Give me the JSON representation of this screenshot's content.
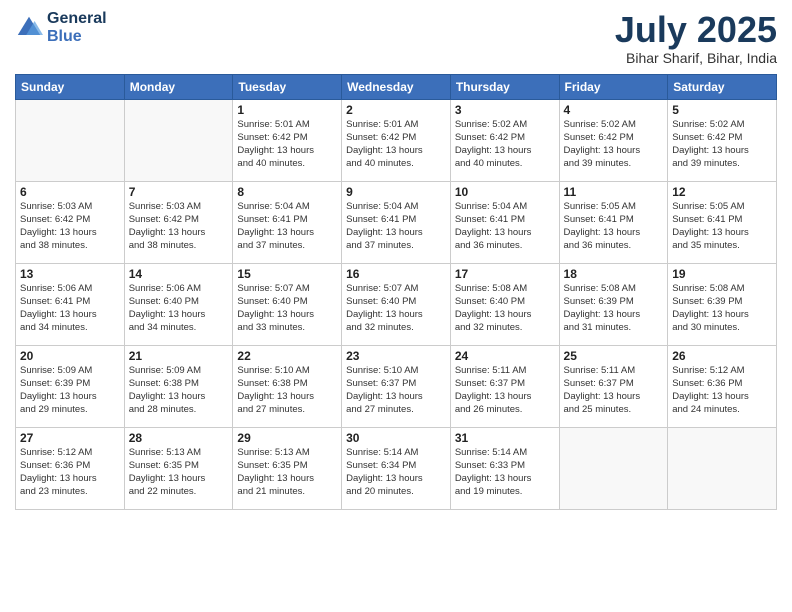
{
  "logo": {
    "line1": "General",
    "line2": "Blue"
  },
  "title": "July 2025",
  "location": "Bihar Sharif, Bihar, India",
  "days_of_week": [
    "Sunday",
    "Monday",
    "Tuesday",
    "Wednesday",
    "Thursday",
    "Friday",
    "Saturday"
  ],
  "weeks": [
    [
      {
        "day": "",
        "info": ""
      },
      {
        "day": "",
        "info": ""
      },
      {
        "day": "1",
        "info": "Sunrise: 5:01 AM\nSunset: 6:42 PM\nDaylight: 13 hours\nand 40 minutes."
      },
      {
        "day": "2",
        "info": "Sunrise: 5:01 AM\nSunset: 6:42 PM\nDaylight: 13 hours\nand 40 minutes."
      },
      {
        "day": "3",
        "info": "Sunrise: 5:02 AM\nSunset: 6:42 PM\nDaylight: 13 hours\nand 40 minutes."
      },
      {
        "day": "4",
        "info": "Sunrise: 5:02 AM\nSunset: 6:42 PM\nDaylight: 13 hours\nand 39 minutes."
      },
      {
        "day": "5",
        "info": "Sunrise: 5:02 AM\nSunset: 6:42 PM\nDaylight: 13 hours\nand 39 minutes."
      }
    ],
    [
      {
        "day": "6",
        "info": "Sunrise: 5:03 AM\nSunset: 6:42 PM\nDaylight: 13 hours\nand 38 minutes."
      },
      {
        "day": "7",
        "info": "Sunrise: 5:03 AM\nSunset: 6:42 PM\nDaylight: 13 hours\nand 38 minutes."
      },
      {
        "day": "8",
        "info": "Sunrise: 5:04 AM\nSunset: 6:41 PM\nDaylight: 13 hours\nand 37 minutes."
      },
      {
        "day": "9",
        "info": "Sunrise: 5:04 AM\nSunset: 6:41 PM\nDaylight: 13 hours\nand 37 minutes."
      },
      {
        "day": "10",
        "info": "Sunrise: 5:04 AM\nSunset: 6:41 PM\nDaylight: 13 hours\nand 36 minutes."
      },
      {
        "day": "11",
        "info": "Sunrise: 5:05 AM\nSunset: 6:41 PM\nDaylight: 13 hours\nand 36 minutes."
      },
      {
        "day": "12",
        "info": "Sunrise: 5:05 AM\nSunset: 6:41 PM\nDaylight: 13 hours\nand 35 minutes."
      }
    ],
    [
      {
        "day": "13",
        "info": "Sunrise: 5:06 AM\nSunset: 6:41 PM\nDaylight: 13 hours\nand 34 minutes."
      },
      {
        "day": "14",
        "info": "Sunrise: 5:06 AM\nSunset: 6:40 PM\nDaylight: 13 hours\nand 34 minutes."
      },
      {
        "day": "15",
        "info": "Sunrise: 5:07 AM\nSunset: 6:40 PM\nDaylight: 13 hours\nand 33 minutes."
      },
      {
        "day": "16",
        "info": "Sunrise: 5:07 AM\nSunset: 6:40 PM\nDaylight: 13 hours\nand 32 minutes."
      },
      {
        "day": "17",
        "info": "Sunrise: 5:08 AM\nSunset: 6:40 PM\nDaylight: 13 hours\nand 32 minutes."
      },
      {
        "day": "18",
        "info": "Sunrise: 5:08 AM\nSunset: 6:39 PM\nDaylight: 13 hours\nand 31 minutes."
      },
      {
        "day": "19",
        "info": "Sunrise: 5:08 AM\nSunset: 6:39 PM\nDaylight: 13 hours\nand 30 minutes."
      }
    ],
    [
      {
        "day": "20",
        "info": "Sunrise: 5:09 AM\nSunset: 6:39 PM\nDaylight: 13 hours\nand 29 minutes."
      },
      {
        "day": "21",
        "info": "Sunrise: 5:09 AM\nSunset: 6:38 PM\nDaylight: 13 hours\nand 28 minutes."
      },
      {
        "day": "22",
        "info": "Sunrise: 5:10 AM\nSunset: 6:38 PM\nDaylight: 13 hours\nand 27 minutes."
      },
      {
        "day": "23",
        "info": "Sunrise: 5:10 AM\nSunset: 6:37 PM\nDaylight: 13 hours\nand 27 minutes."
      },
      {
        "day": "24",
        "info": "Sunrise: 5:11 AM\nSunset: 6:37 PM\nDaylight: 13 hours\nand 26 minutes."
      },
      {
        "day": "25",
        "info": "Sunrise: 5:11 AM\nSunset: 6:37 PM\nDaylight: 13 hours\nand 25 minutes."
      },
      {
        "day": "26",
        "info": "Sunrise: 5:12 AM\nSunset: 6:36 PM\nDaylight: 13 hours\nand 24 minutes."
      }
    ],
    [
      {
        "day": "27",
        "info": "Sunrise: 5:12 AM\nSunset: 6:36 PM\nDaylight: 13 hours\nand 23 minutes."
      },
      {
        "day": "28",
        "info": "Sunrise: 5:13 AM\nSunset: 6:35 PM\nDaylight: 13 hours\nand 22 minutes."
      },
      {
        "day": "29",
        "info": "Sunrise: 5:13 AM\nSunset: 6:35 PM\nDaylight: 13 hours\nand 21 minutes."
      },
      {
        "day": "30",
        "info": "Sunrise: 5:14 AM\nSunset: 6:34 PM\nDaylight: 13 hours\nand 20 minutes."
      },
      {
        "day": "31",
        "info": "Sunrise: 5:14 AM\nSunset: 6:33 PM\nDaylight: 13 hours\nand 19 minutes."
      },
      {
        "day": "",
        "info": ""
      },
      {
        "day": "",
        "info": ""
      }
    ]
  ]
}
